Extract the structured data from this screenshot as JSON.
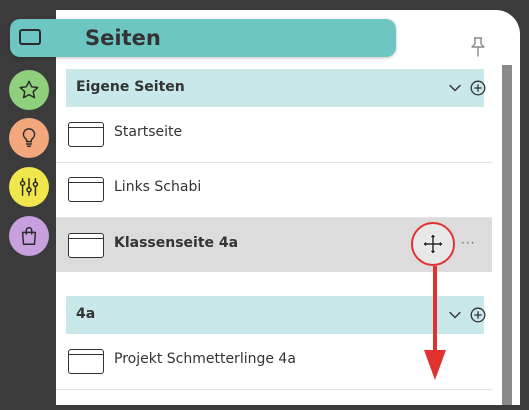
{
  "header": {
    "title": "Seiten"
  },
  "sections": [
    {
      "label": "Eigene Seiten",
      "items": [
        {
          "label": "Startseite"
        },
        {
          "label": "Links Schabi"
        },
        {
          "label": "Klassenseite 4a"
        }
      ]
    },
    {
      "label": "4a",
      "items": [
        {
          "label": "Projekt Schmetterlinge 4a"
        }
      ]
    }
  ],
  "selected_item": "Klassenseite 4a",
  "rail_buttons": [
    {
      "icon": "star-icon",
      "color": "#8fd07d"
    },
    {
      "icon": "lightbulb-icon",
      "color": "#f3a77d"
    },
    {
      "icon": "sliders-icon",
      "color": "#f1e64d"
    },
    {
      "icon": "shopping-bag-icon",
      "color": "#c8a0dd"
    }
  ],
  "colors": {
    "header": "#6ec6c3",
    "section_header": "#c8e8ea",
    "selected_row": "#dcdcdc",
    "annotation_red": "#e0332f"
  }
}
